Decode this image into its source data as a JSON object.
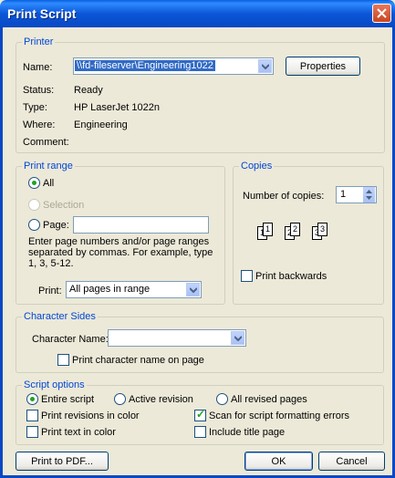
{
  "window": {
    "title": "Print Script"
  },
  "printer": {
    "legend": "Printer",
    "name_label": "Name:",
    "name_value": "\\\\fd-fileserver\\Engineering1022",
    "properties_label": "Properties",
    "status_label": "Status:",
    "status_value": "Ready",
    "type_label": "Type:",
    "type_value": "HP LaserJet 1022n",
    "where_label": "Where:",
    "where_value": "Engineering",
    "comment_label": "Comment:"
  },
  "print_range": {
    "legend": "Print range",
    "all_label": "All",
    "selection_label": "Selection",
    "page_label": "Page:",
    "help_line1": "Enter page numbers and/or page ranges",
    "help_line2": "separated by commas. For example, type",
    "help_line3": "1, 3, 5-12.",
    "print_label": "Print:",
    "print_value": "All pages in range"
  },
  "copies": {
    "legend": "Copies",
    "number_label": "Number of copies:",
    "number_value": "1",
    "backwards_label": "Print backwards",
    "page_numbers": [
      "1",
      "1",
      "2",
      "2",
      "3",
      "3"
    ]
  },
  "character_sides": {
    "legend": "Character Sides",
    "name_label": "Character Name:",
    "name_value": "",
    "print_name_label": "Print character name on page"
  },
  "script_options": {
    "legend": "Script options",
    "entire_label": "Entire script",
    "active_label": "Active revision",
    "revised_label": "All revised pages",
    "revisions_color_label": "Print revisions in color",
    "scan_label": "Scan for script formatting errors",
    "text_color_label": "Print text in color",
    "title_page_label": "Include title page"
  },
  "footer": {
    "pdf_label": "Print to PDF...",
    "ok_label": "OK",
    "cancel_label": "Cancel"
  },
  "colors": {
    "title_bar": "#0848C4",
    "legend_text": "#0046D5",
    "dialog_bg": "#ECE9D8"
  }
}
